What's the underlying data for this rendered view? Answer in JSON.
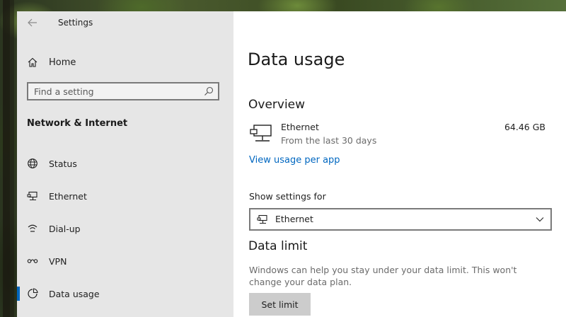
{
  "window": {
    "title": "Settings"
  },
  "sidebar": {
    "home_label": "Home",
    "search": {
      "placeholder": "Find a setting",
      "value": ""
    },
    "section_heading": "Network & Internet",
    "items": [
      {
        "label": "Status",
        "icon": "globe-icon",
        "selected": false
      },
      {
        "label": "Ethernet",
        "icon": "ethernet-icon",
        "selected": false
      },
      {
        "label": "Dial-up",
        "icon": "dialup-icon",
        "selected": false
      },
      {
        "label": "VPN",
        "icon": "vpn-icon",
        "selected": false
      },
      {
        "label": "Data usage",
        "icon": "data-usage-icon",
        "selected": true
      }
    ]
  },
  "main": {
    "title": "Data usage",
    "overview": {
      "heading": "Overview",
      "network_name": "Ethernet",
      "period": "From the last 30 days",
      "total": "64.46 GB",
      "icon": "ethernet-icon"
    },
    "view_usage_link": "View usage per app",
    "show_settings": {
      "label": "Show settings for",
      "selected": "Ethernet"
    },
    "data_limit": {
      "heading": "Data limit",
      "description": "Windows can help you stay under your data limit. This won't change your data plan.",
      "button_label": "Set limit"
    }
  },
  "colors": {
    "accent": "#0067c0",
    "sidebar_bg": "#e6e6e6",
    "main_bg": "#ffffff",
    "button_bg": "#cccccc"
  }
}
